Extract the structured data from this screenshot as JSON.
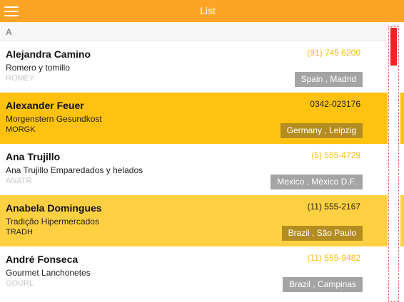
{
  "header": {
    "title": "List",
    "menu_icon": "hamburger-menu-icon",
    "background": "#fda427"
  },
  "list": {
    "group_label": "A",
    "items": [
      {
        "name": "Alejandra Camino",
        "company": "Romero y tomillo",
        "code": "ROMEY",
        "phone": "(91) 745 6200",
        "location": "Spain , Madrid"
      },
      {
        "name": "Alexander Feuer",
        "company": "Morgenstern Gesundkost",
        "code": "MORGK",
        "phone": "0342-023176",
        "location": "Germany , Leipzig"
      },
      {
        "name": "Ana Trujillo",
        "company": "Ana Trujillo Emparedados y helados",
        "code": "ANATR",
        "phone": "(5) 555-4729",
        "location": "Mexico , México D.F."
      },
      {
        "name": "Anabela Domingues",
        "company": "Tradição Hipermercados",
        "code": "TRADH",
        "phone": "(11) 555-2167",
        "location": "Brazil , São Paulo"
      },
      {
        "name": "André Fonseca",
        "company": "Gourmet Lanchonetes",
        "code": "GOURL",
        "phone": "(11) 555-9482",
        "location": "Brazil , Campinas"
      }
    ]
  },
  "colors": {
    "selected_row": "#fec20f",
    "alternate_row": "#ffd041",
    "phone_accent": "#fbbc0d",
    "scroll_thumb": "#ee2222"
  }
}
